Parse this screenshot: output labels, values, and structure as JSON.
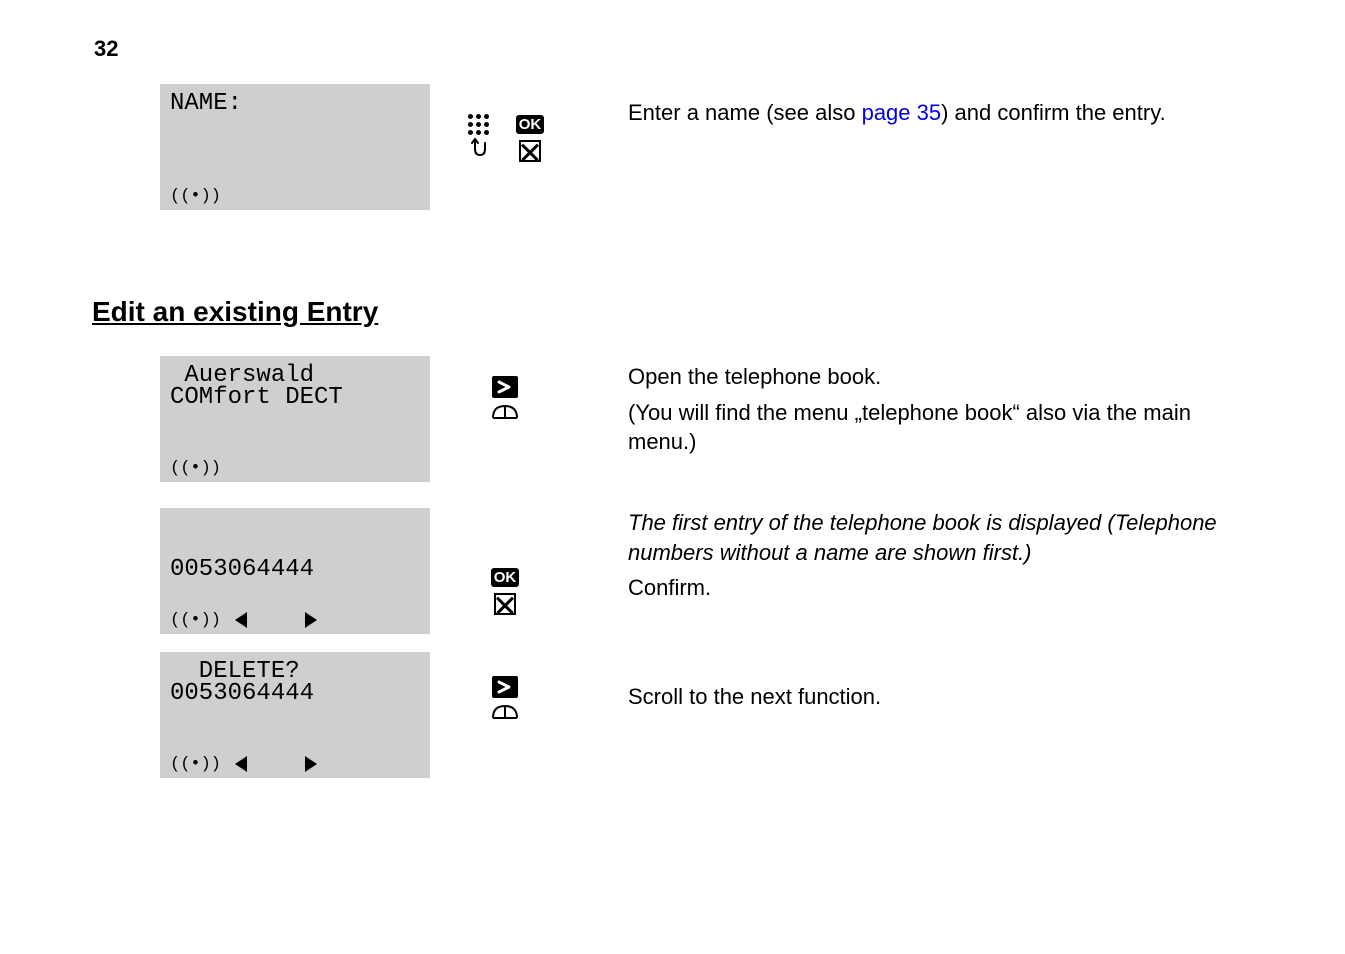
{
  "page_number": "32",
  "row1": {
    "lcd_line1": "NAME:",
    "lcd_line2": "",
    "desc_before_link": "Enter a name (see also ",
    "link_text": "page 35",
    "desc_after_link": ") and confirm the entry."
  },
  "section_heading": "Edit an existing Entry",
  "row2": {
    "lcd_line1": " Auerswald",
    "lcd_line2": "COMfort DECT",
    "desc_p1": "Open the telephone book.",
    "desc_p2": "(You will find the menu „telephone book“ also via the main menu.)"
  },
  "row3": {
    "lcd_line1": "0053064444",
    "desc_italic": "The first entry of the telephone book is displayed (Telephone numbers without a name are shown first.)",
    "desc_p2": "Confirm."
  },
  "row4": {
    "lcd_line1": "  DELETE?",
    "lcd_line2": "0053064444",
    "desc_p1": "Scroll to the next function."
  }
}
